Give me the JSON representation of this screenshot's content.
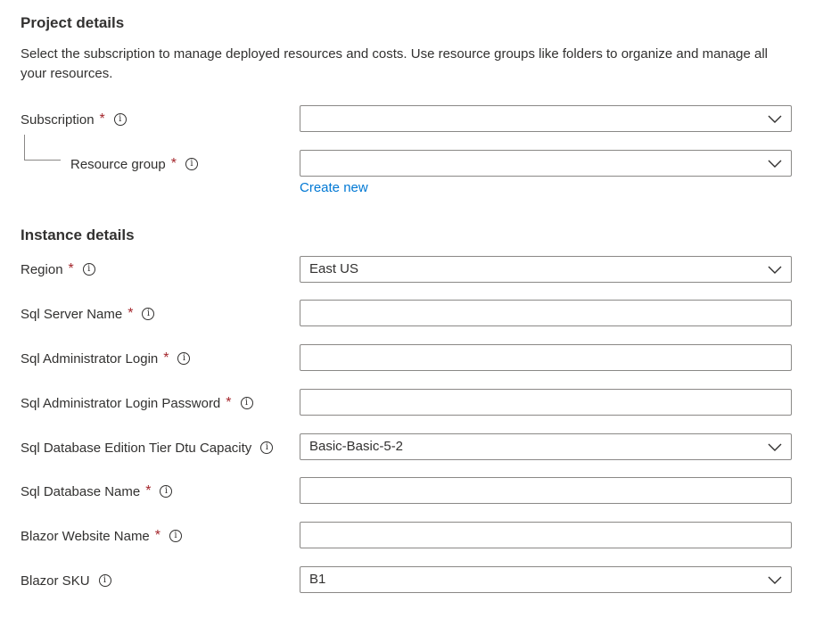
{
  "project": {
    "heading": "Project details",
    "description": "Select the subscription to manage deployed resources and costs. Use resource groups like folders to organize and manage all your resources.",
    "subscription": {
      "label": "Subscription",
      "required": "*",
      "value": ""
    },
    "resource_group": {
      "label": "Resource group",
      "required": "*",
      "value": "",
      "create_new": "Create new"
    }
  },
  "instance": {
    "heading": "Instance details",
    "region": {
      "label": "Region",
      "required": "*",
      "value": "East US"
    },
    "sql_server_name": {
      "label": "Sql Server Name",
      "required": "*",
      "value": ""
    },
    "sql_admin_login": {
      "label": "Sql Administrator Login",
      "required": "*",
      "value": ""
    },
    "sql_admin_password": {
      "label": "Sql Administrator Login Password",
      "required": "*",
      "value": ""
    },
    "sql_db_tier": {
      "label": "Sql Database Edition Tier Dtu Capacity",
      "value": "Basic-Basic-5-2"
    },
    "sql_db_name": {
      "label": "Sql Database Name",
      "required": "*",
      "value": ""
    },
    "blazor_site_name": {
      "label": "Blazor Website Name",
      "required": "*",
      "value": ""
    },
    "blazor_sku": {
      "label": "Blazor SKU",
      "value": "B1"
    }
  },
  "icons": {
    "info": "info-icon",
    "dropdown": "chevron-down-icon"
  },
  "colors": {
    "required": "#a4262c",
    "link": "#0078d4",
    "border": "#8a8886",
    "text": "#323130"
  },
  "info_glyph": "i"
}
